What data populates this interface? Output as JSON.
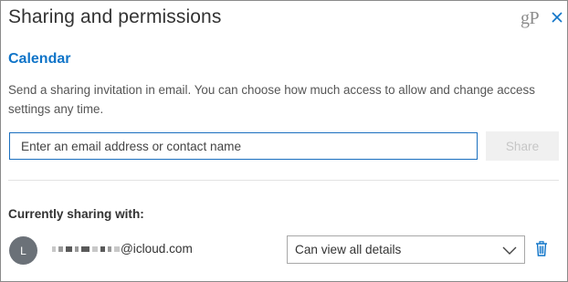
{
  "dialog": {
    "title": "Sharing and permissions",
    "watermark": "gP",
    "close_icon": "close-icon",
    "subheading": "Calendar",
    "description": "Send a sharing invitation in email. You can choose how much access to allow and change access settings any time.",
    "accent_color": "#0f74c8"
  },
  "invite": {
    "email_placeholder": "Enter an email address or contact name",
    "email_value": "",
    "share_label": "Share",
    "share_enabled": false
  },
  "sharing": {
    "heading": "Currently sharing with:",
    "people": [
      {
        "avatar_initial": "L",
        "email_visible_part": "@icloud.com",
        "email_redacted": true,
        "permission": "Can view all details",
        "delete_icon": "trash-icon"
      }
    ]
  }
}
